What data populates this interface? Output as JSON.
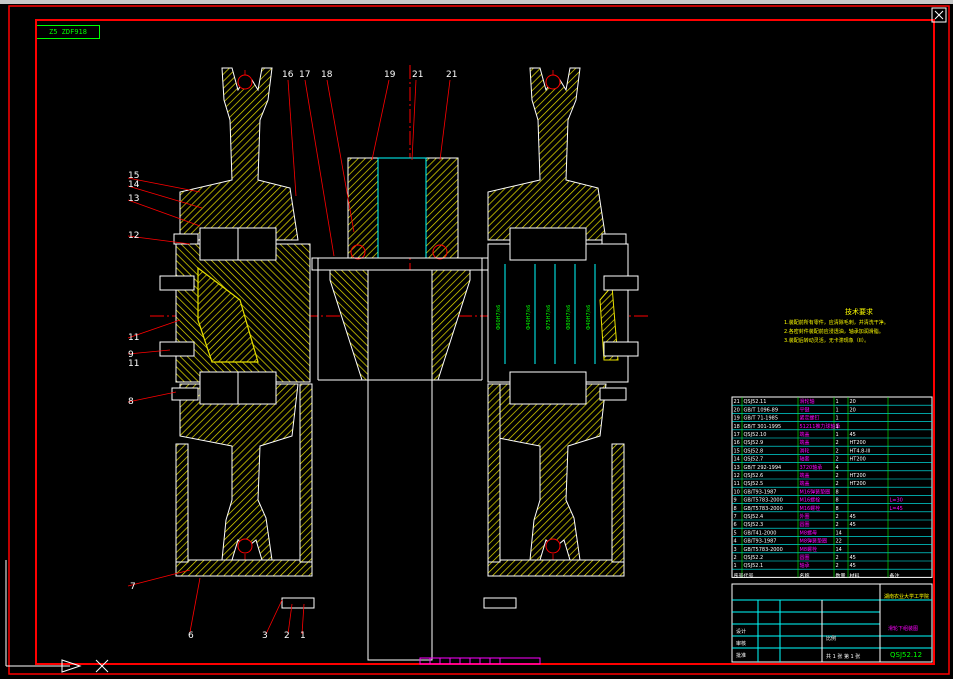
{
  "drawing_tag": "Z5 ZDF918",
  "part_labels": {
    "top": [
      "16",
      "17",
      "18",
      "19",
      "21",
      "21"
    ],
    "left": [
      "15",
      "14",
      "13",
      "12",
      "11",
      "9",
      "11",
      "8",
      "7"
    ],
    "bottom": [
      "6",
      "3",
      "2",
      "1"
    ]
  },
  "dimension_texts": [
    "Ф60H7/k6",
    "Ф40H7/k6",
    "Ф75H7/k6",
    "Ф80H7/k6",
    "Ф40H7/k6"
  ],
  "tech_requirements": {
    "title": "技术要求",
    "lines": [
      "1.装配前所有零件，应清除毛刺，并清洗干净。",
      "2.各密封件装配前应浸透油，轴承加润滑脂。",
      "3.装配后转动灵活，无卡滞现象（II）。"
    ]
  },
  "bom": [
    {
      "no": "21",
      "code": "QSJ52.11",
      "name": "滑轮轴",
      "qty": "1",
      "mat": "20",
      "note": ""
    },
    {
      "no": "20",
      "code": "GB/T 1096-89",
      "name": "平键",
      "qty": "1",
      "mat": "20",
      "note": ""
    },
    {
      "no": "19",
      "code": "GB/T 71-1985",
      "name": "紧定螺钉",
      "qty": "1",
      "mat": "",
      "note": ""
    },
    {
      "no": "18",
      "code": "GB/T 301-1995",
      "name": "51211推力球轴承",
      "qty": "1",
      "mat": "",
      "note": ""
    },
    {
      "no": "17",
      "code": "QSJ52.10",
      "name": "端盖",
      "qty": "1",
      "mat": "45",
      "note": ""
    },
    {
      "no": "16",
      "code": "QSJ52.9",
      "name": "端盖",
      "qty": "2",
      "mat": "HT200",
      "note": ""
    },
    {
      "no": "15",
      "code": "QSJ52.8",
      "name": "滑轮",
      "qty": "2",
      "mat": "HT4.8-III",
      "note": ""
    },
    {
      "no": "14",
      "code": "QSJ52.7",
      "name": "轴套",
      "qty": "2",
      "mat": "HT200",
      "note": ""
    },
    {
      "no": "13",
      "code": "GB/T 292-1994",
      "name": "3720轴承",
      "qty": "4",
      "mat": "",
      "note": ""
    },
    {
      "no": "12",
      "code": "QSJ52.6",
      "name": "端盖",
      "qty": "2",
      "mat": "HT200",
      "note": ""
    },
    {
      "no": "11",
      "code": "QSJ52.5",
      "name": "端盖",
      "qty": "2",
      "mat": "HT200",
      "note": ""
    },
    {
      "no": "10",
      "code": "GB/T93-1987",
      "name": "M16弹簧垫圈",
      "qty": "8",
      "mat": "",
      "note": ""
    },
    {
      "no": "9",
      "code": "GB/T5783-2000",
      "name": "M16螺栓",
      "qty": "8",
      "mat": "",
      "note": "L=30"
    },
    {
      "no": "8",
      "code": "GB/T5783-2000",
      "name": "M16螺栓",
      "qty": "8",
      "mat": "",
      "note": "L=45"
    },
    {
      "no": "7",
      "code": "QSJ52.4",
      "name": "外圈",
      "qty": "2",
      "mat": "45",
      "note": ""
    },
    {
      "no": "6",
      "code": "QSJ52.3",
      "name": "圆圈",
      "qty": "2",
      "mat": "45",
      "note": ""
    },
    {
      "no": "5",
      "code": "GB/T41-2000",
      "name": "M8螺母",
      "qty": "14",
      "mat": "",
      "note": ""
    },
    {
      "no": "4",
      "code": "GB/T93-1987",
      "name": "M8弹簧垫圈",
      "qty": "22",
      "mat": "",
      "note": ""
    },
    {
      "no": "3",
      "code": "GB/T5783-2000",
      "name": "M8螺栓",
      "qty": "14",
      "mat": "",
      "note": ""
    },
    {
      "no": "2",
      "code": "QSJ52.2",
      "name": "圆圈",
      "qty": "2",
      "mat": "45",
      "note": ""
    },
    {
      "no": "1",
      "code": "QSJ52.1",
      "name": "轴承",
      "qty": "2",
      "mat": "45",
      "note": ""
    }
  ],
  "bom_header": [
    "序号",
    "代号",
    "名称",
    "数量",
    "材料",
    "备注"
  ],
  "title_block": {
    "institution": "湖南农业大学工学院",
    "drawing_name": "滑轮下组装图",
    "drawing_no": "QSJ52.12",
    "scale_label": "比例",
    "sheet_label": "共 1 张 第 1 张",
    "design_label": "设计",
    "check_label": "审核",
    "approve_label": "批准"
  },
  "colors": {
    "frame": "#ff0000",
    "hatch": "#e8e000",
    "lines": "#ffffff",
    "centerline": "#ff0000",
    "cyan": "#00ffff",
    "green": "#00ff00",
    "magenta": "#ff00ff"
  }
}
